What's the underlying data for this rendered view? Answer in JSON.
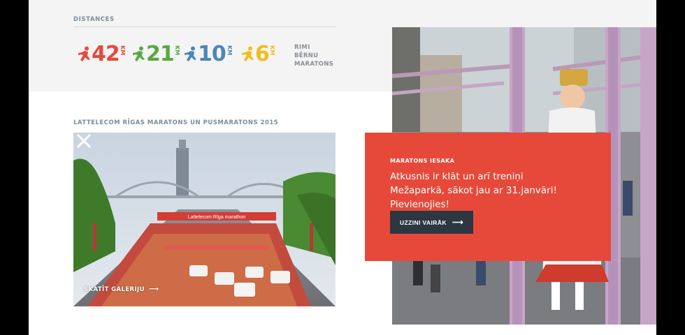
{
  "distances": {
    "title": "DISTANCES",
    "items": [
      {
        "value": "42",
        "unit": "KM",
        "color": "#e64a3b"
      },
      {
        "value": "21",
        "unit": "KM",
        "color": "#5aa840"
      },
      {
        "value": "10",
        "unit": "KM",
        "color": "#4f86b6"
      },
      {
        "value": "6",
        "unit": "KM",
        "color": "#f2bd1c"
      }
    ],
    "kids": [
      "RIMI",
      "BĒRNU",
      "MARATONS"
    ]
  },
  "gallery": {
    "title": "LATTELECOM RĪGAS MARATONS UN PUSMARATONS 2015",
    "view_label": "SKATĪT GALERIJU",
    "banner_text": "Lattelecom Rīga marathon",
    "prev_icon": "chevron-left-icon",
    "next_icon": "chevron-right-icon"
  },
  "promo": {
    "tag": "MARATONS IESAKA",
    "text": "Atkusnis ir klāt un arī treniņi Mežaparkā, sākot jau ar 31.janvāri! Pievienojies!",
    "button_label": "UZZINI VAIRĀK",
    "bg_color": "#e6493a",
    "button_color": "#2c3741"
  }
}
